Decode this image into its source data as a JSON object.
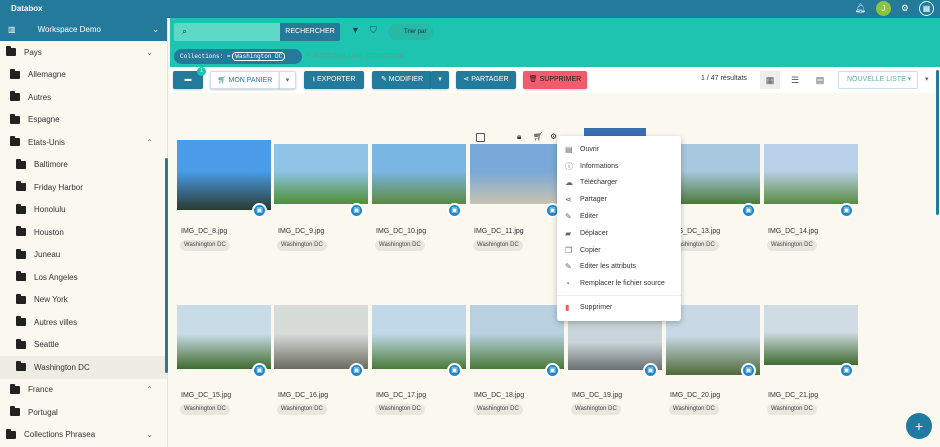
{
  "app": {
    "title": "Databox",
    "avatar_initial": "J",
    "icons": [
      "bell-icon",
      "gear-icon",
      "apps-icon"
    ]
  },
  "sidebar": {
    "workspace": "Workspace Demo",
    "items": [
      {
        "label": "Pays",
        "level": 0,
        "chevron": "down"
      },
      {
        "label": "Allemagne",
        "level": 1
      },
      {
        "label": "Autres",
        "level": 1
      },
      {
        "label": "Espagne",
        "level": 1
      },
      {
        "label": "Etats-Unis",
        "level": 1,
        "chevron": "up"
      },
      {
        "label": "Baltimore",
        "level": 2
      },
      {
        "label": "Friday Harbor",
        "level": 2
      },
      {
        "label": "Honolulu",
        "level": 2
      },
      {
        "label": "Houston",
        "level": 2
      },
      {
        "label": "Juneau",
        "level": 2
      },
      {
        "label": "Los Angeles",
        "level": 2
      },
      {
        "label": "New York",
        "level": 2
      },
      {
        "label": "Autres villes",
        "level": 2
      },
      {
        "label": "Seattle",
        "level": 2
      },
      {
        "label": "Washington DC",
        "level": 2,
        "selected": true
      },
      {
        "label": "France",
        "level": 1,
        "chevron": "up"
      },
      {
        "label": "Portugal",
        "level": 1
      },
      {
        "label": "Collections Phrasea",
        "level": 0,
        "chevron": "down"
      }
    ]
  },
  "search": {
    "button": "RECHERCHER",
    "sort": "Trier par",
    "chip_key": "Collections",
    "chip_op": "=",
    "chip_value": "Washington DC",
    "add_condition": "AJOUTER UNE CONDITION"
  },
  "toolbar": {
    "selection_count": "1",
    "basket": "MON PANIER",
    "export": "EXPORTER",
    "modify": "MODIFIER",
    "share": "PARTAGER",
    "delete": "SUPPRIMER",
    "results": "1 / 47 résultats",
    "new_list": "NOUVELLE LISTE"
  },
  "cards": [
    {
      "name": "IMG_DC_8.jpg",
      "tag": "Washington DC",
      "colors": [
        "#4a9be8",
        "#2a3a30"
      ]
    },
    {
      "name": "IMG_DC_9.jpg",
      "tag": "Washington DC",
      "colors": [
        "#8fc4e6",
        "#4f8f35"
      ]
    },
    {
      "name": "IMG_DC_10.jpg",
      "tag": "Washington DC",
      "colors": [
        "#7ab6e3",
        "#5d8a40"
      ]
    },
    {
      "name": "IMG_DC_11.jpg",
      "tag": "Washington DC",
      "colors": [
        "#7aa8d8",
        "#c8c2b0"
      ]
    },
    {
      "name": "",
      "tag": "",
      "colors": [
        "#3a6fb0",
        "#8a7a60"
      ]
    },
    {
      "name": "IMG_DC_13.jpg",
      "tag": "Washington DC",
      "colors": [
        "#a8c8e0",
        "#4a7a38"
      ]
    },
    {
      "name": "IMG_DC_14.jpg",
      "tag": "Washington DC",
      "colors": [
        "#b8d0e8",
        "#5a8a40"
      ]
    },
    {
      "name": "IMG_DC_15.jpg",
      "tag": "Washington DC",
      "colors": [
        "#c8dce8",
        "#3f6a2e"
      ]
    },
    {
      "name": "IMG_DC_16.jpg",
      "tag": "Washington DC",
      "colors": [
        "#d8dcd8",
        "#6a6a60"
      ]
    },
    {
      "name": "IMG_DC_17.jpg",
      "tag": "Washington DC",
      "colors": [
        "#c0d8e8",
        "#4a7a38"
      ]
    },
    {
      "name": "IMG_DC_18.jpg",
      "tag": "Washington DC",
      "colors": [
        "#b8d0e0",
        "#4a7a38"
      ]
    },
    {
      "name": "IMG_DC_19.jpg",
      "tag": "Washington DC",
      "colors": [
        "#c8d4d8",
        "#6a7070"
      ]
    },
    {
      "name": "IMG_DC_20.jpg",
      "tag": "Washington DC",
      "colors": [
        "#c8d8e4",
        "#4f6a3a"
      ]
    },
    {
      "name": "IMG_DC_21.jpg",
      "tag": "Washington DC",
      "colors": [
        "#d0dce4",
        "#3f6a30"
      ]
    }
  ],
  "context_menu": [
    {
      "label": "Ouvrir",
      "icon": "file-icon",
      "glyph": "▤"
    },
    {
      "label": "Informations",
      "icon": "info-icon",
      "glyph": "ⓘ"
    },
    {
      "label": "Télécharger",
      "icon": "cloud-download-icon",
      "glyph": "☁"
    },
    {
      "label": "Partager",
      "icon": "share-icon",
      "glyph": "⋖"
    },
    {
      "label": "Editer",
      "icon": "pencil-icon",
      "glyph": "✎"
    },
    {
      "label": "Déplacer",
      "icon": "folder-move-icon",
      "glyph": "▰"
    },
    {
      "label": "Copier",
      "icon": "copy-icon",
      "glyph": "❐"
    },
    {
      "label": "Editer les attributs",
      "icon": "pencil-icon",
      "glyph": "✎"
    },
    {
      "label": "Remplacer le fichier source",
      "icon": "replace-icon",
      "glyph": "◔"
    }
  ],
  "context_menu_delete": {
    "label": "Supprimer",
    "icon": "trash-icon",
    "color": "#f15b6c"
  }
}
